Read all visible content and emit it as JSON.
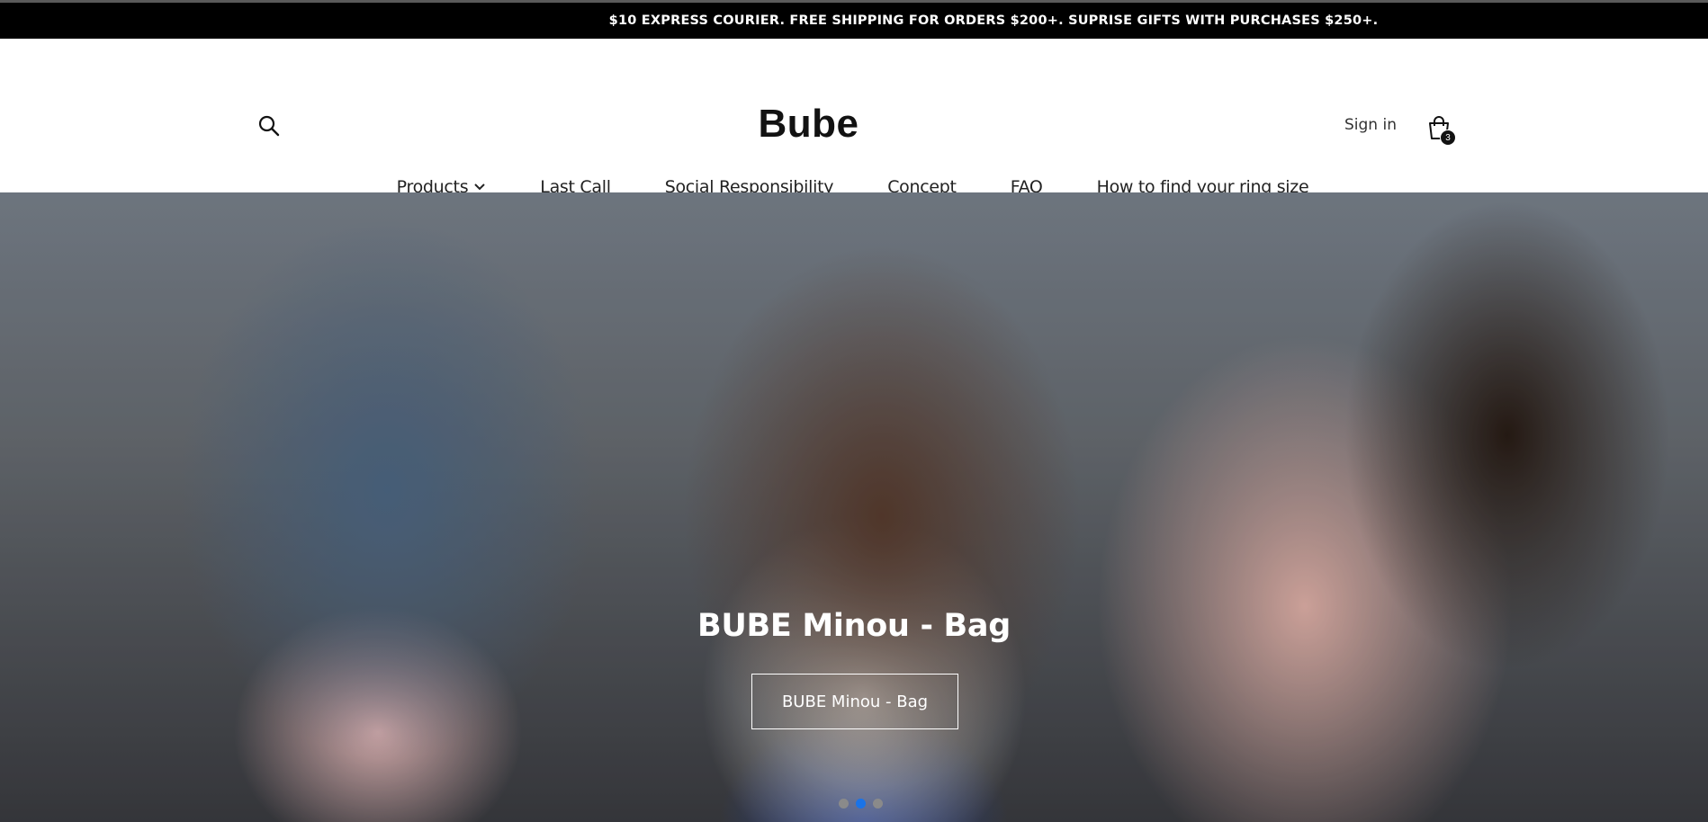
{
  "announcement": {
    "text": "$10 EXPRESS COURIER. FREE SHIPPING FOR ORDERS $200+. SUPRISE GIFTS WITH PURCHASES $250+."
  },
  "header": {
    "logo": "Bube",
    "sign_in": "Sign in",
    "cart_count": "3",
    "search_icon": "search-icon",
    "cart_icon": "shopping-bag-icon"
  },
  "nav": {
    "items": [
      {
        "label": "Products",
        "has_dropdown": true
      },
      {
        "label": "Last Call"
      },
      {
        "label": "Social Responsibility"
      },
      {
        "label": "Concept"
      },
      {
        "label": "FAQ"
      },
      {
        "label": "How to find your ring size"
      }
    ]
  },
  "hero": {
    "title": "BUBE Minou - Bag",
    "button_label": "BUBE Minou - Bag",
    "slides": 3,
    "active_slide": 2,
    "dot_active_color": "#1a73e8"
  }
}
